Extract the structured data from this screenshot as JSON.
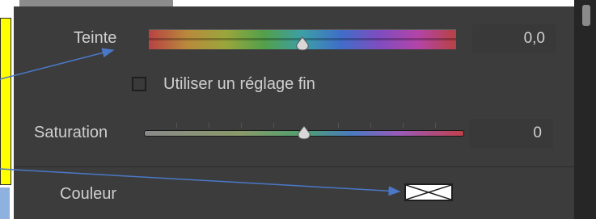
{
  "color_panel": {
    "hue": {
      "label": "Teinte",
      "value": "0,0",
      "level_percent": 50
    },
    "fine_adjust": {
      "label": "Utiliser un réglage fin",
      "checked": false
    },
    "saturation": {
      "label": "Saturation",
      "value": "0",
      "level_percent": 50
    },
    "color": {
      "label": "Couleur"
    }
  },
  "colors": {
    "panel_bg": "#3c3c3c",
    "text": "#cfcfcf",
    "annotation_yellow": "#ffff00",
    "annotation_arrow": "#4a78c8"
  }
}
